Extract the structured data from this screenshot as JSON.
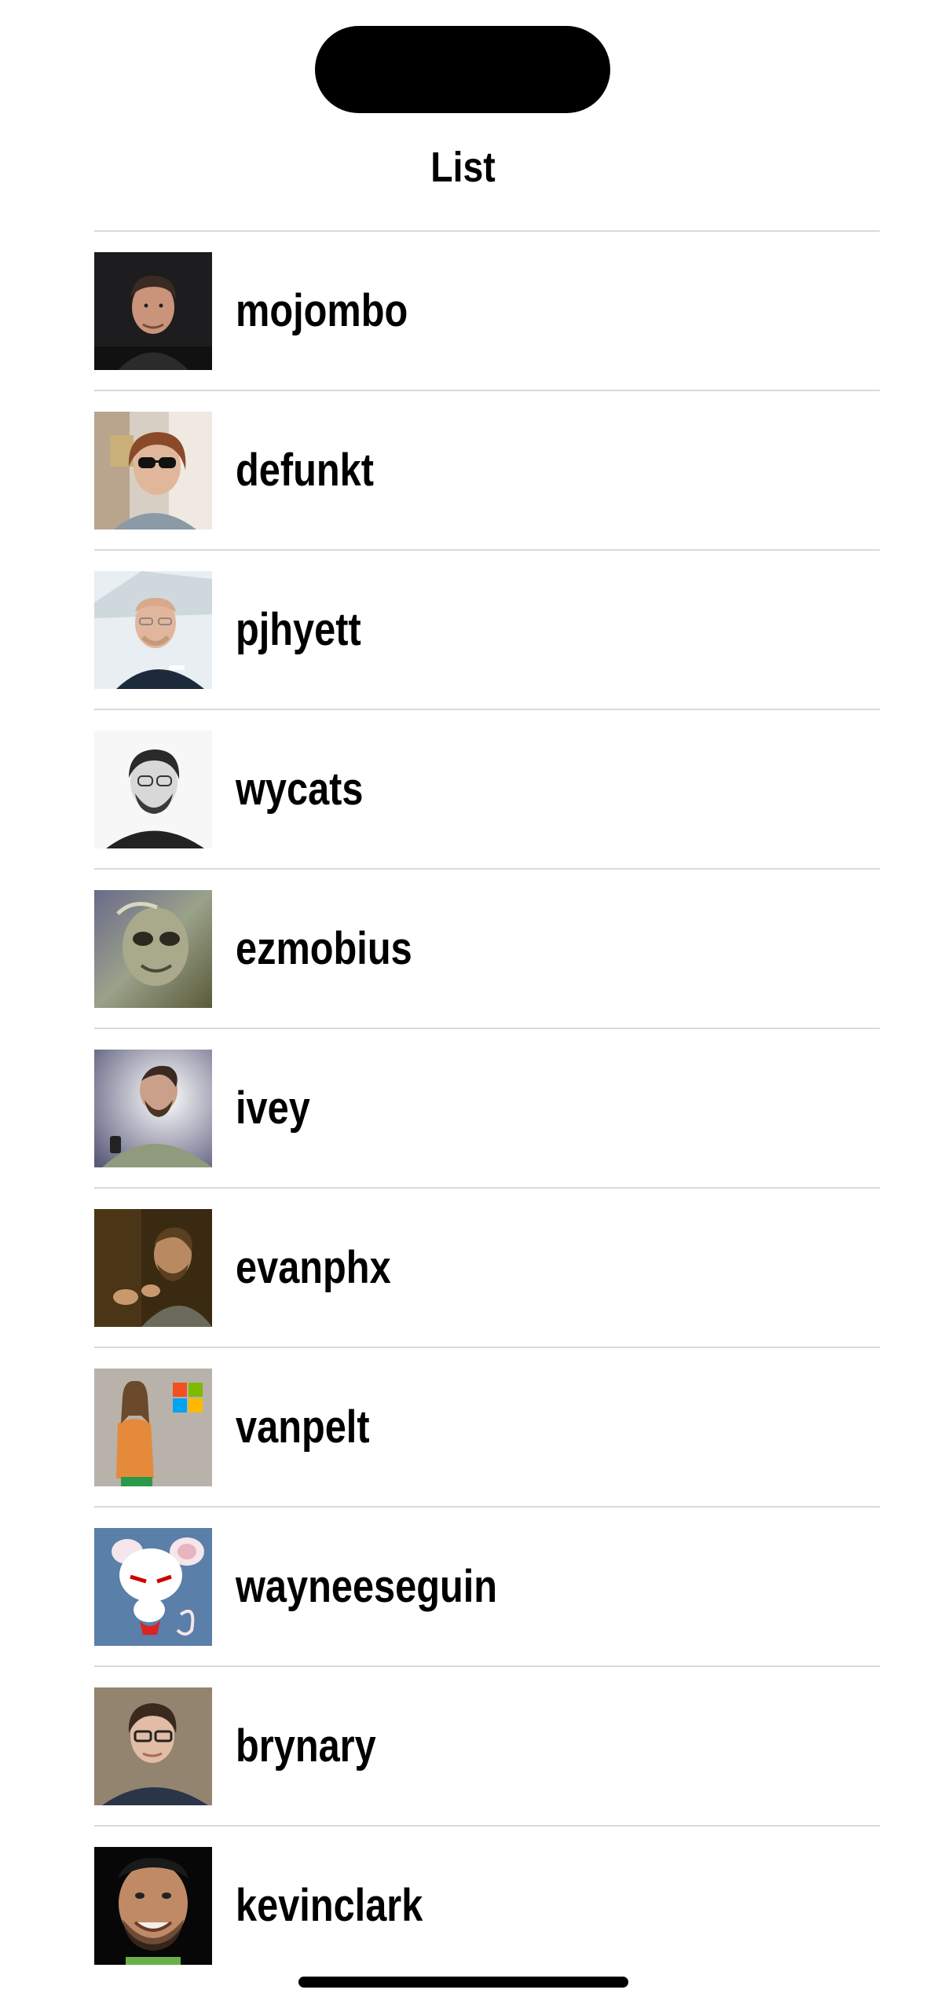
{
  "nav": {
    "title": "List"
  },
  "users": [
    {
      "login": "mojombo",
      "avatar_icon": "avatar-photo-icon"
    },
    {
      "login": "defunkt",
      "avatar_icon": "avatar-photo-icon"
    },
    {
      "login": "pjhyett",
      "avatar_icon": "avatar-photo-icon"
    },
    {
      "login": "wycats",
      "avatar_icon": "avatar-photo-icon"
    },
    {
      "login": "ezmobius",
      "avatar_icon": "avatar-photo-icon"
    },
    {
      "login": "ivey",
      "avatar_icon": "avatar-photo-icon"
    },
    {
      "login": "evanphx",
      "avatar_icon": "avatar-photo-icon"
    },
    {
      "login": "vanpelt",
      "avatar_icon": "avatar-photo-icon"
    },
    {
      "login": "wayneeseguin",
      "avatar_icon": "avatar-cartoon-icon"
    },
    {
      "login": "brynary",
      "avatar_icon": "avatar-photo-icon"
    },
    {
      "login": "kevinclark",
      "avatar_icon": "avatar-photo-icon"
    }
  ],
  "colors": {
    "divider": "#d9d9d9",
    "text": "#000000",
    "background": "#ffffff"
  }
}
